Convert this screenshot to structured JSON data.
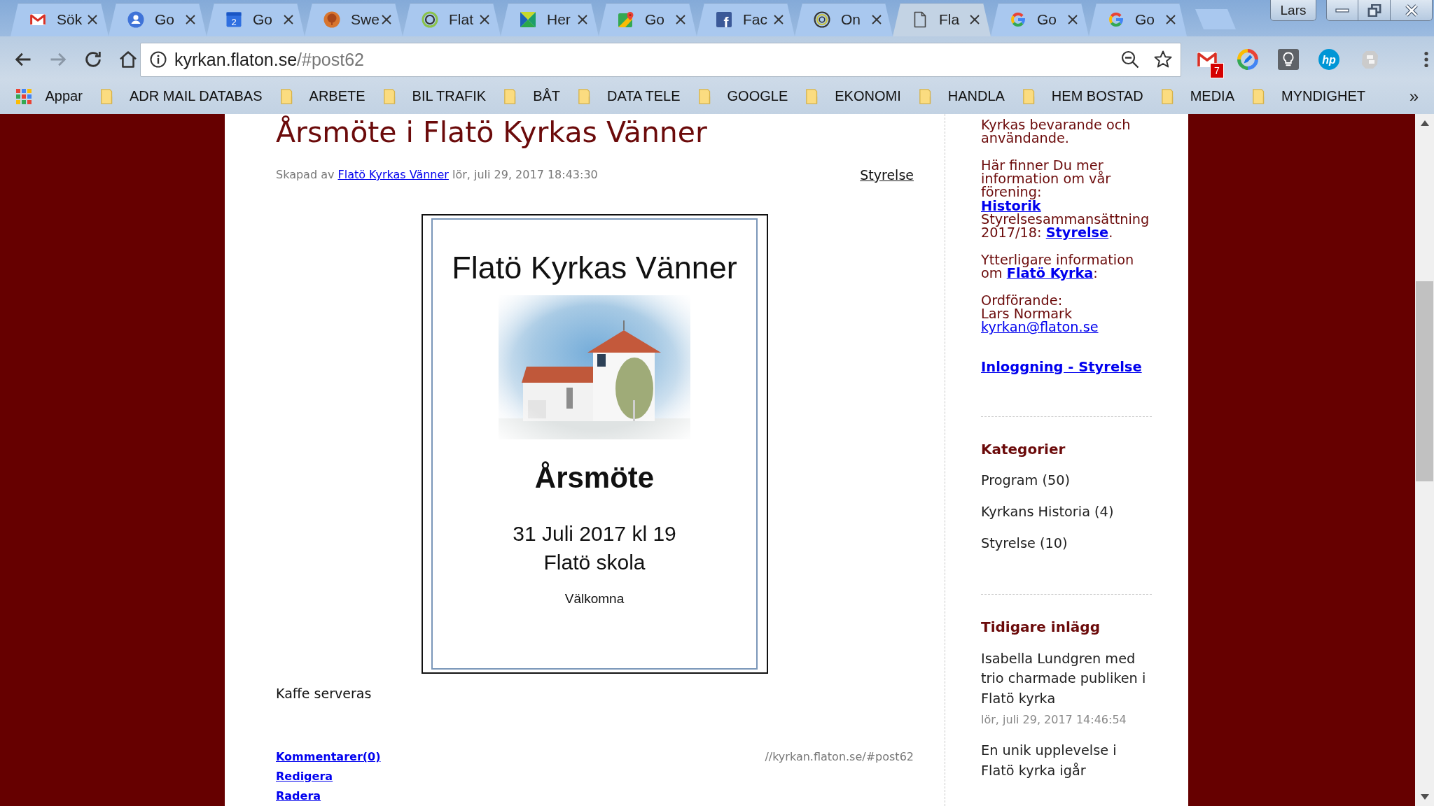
{
  "browser": {
    "tabs": [
      {
        "kind": "gmail",
        "label": "Sök",
        "selected": false
      },
      {
        "kind": "contacts",
        "label": "Go",
        "selected": false
      },
      {
        "kind": "calendar",
        "icon_text": "2",
        "label": "Go",
        "selected": false
      },
      {
        "kind": "tree",
        "label": "Swe",
        "selected": false
      },
      {
        "kind": "ring_green",
        "label": "Flat",
        "selected": false
      },
      {
        "kind": "kite",
        "label": "Her",
        "selected": false
      },
      {
        "kind": "maps",
        "label": "Go",
        "selected": false
      },
      {
        "kind": "facebook",
        "icon_text": "f",
        "label": "Fac",
        "selected": false
      },
      {
        "kind": "ring_yellow",
        "label": "On",
        "selected": false
      },
      {
        "kind": "page",
        "label": "Fla",
        "selected": true
      },
      {
        "kind": "google",
        "label": "Go",
        "selected": false
      },
      {
        "kind": "google",
        "label": "Go",
        "selected": false
      }
    ],
    "profile": "Lars",
    "nav_buttons": [
      {
        "kind": "back",
        "disabled": false
      },
      {
        "kind": "forward",
        "disabled": true
      },
      {
        "kind": "reload",
        "disabled": false
      },
      {
        "kind": "home",
        "disabled": false
      }
    ],
    "address": {
      "host": "kyrkan.flaton.se",
      "path": "/#post62"
    },
    "extensions": [
      {
        "kind": "mail",
        "badge": "7"
      },
      {
        "kind": "pen"
      },
      {
        "kind": "bulb"
      },
      {
        "kind": "logo",
        "label": "hp"
      },
      {
        "kind": "cloud"
      }
    ],
    "bookmarks": [
      {
        "kind": "apps",
        "label": "Appar"
      },
      {
        "kind": "folder",
        "label": "ADR MAIL DATABAS"
      },
      {
        "kind": "folder",
        "label": "ARBETE"
      },
      {
        "kind": "folder",
        "label": "BIL TRAFIK"
      },
      {
        "kind": "folder",
        "label": "BÅT"
      },
      {
        "kind": "folder",
        "label": "DATA TELE"
      },
      {
        "kind": "folder",
        "label": "GOOGLE"
      },
      {
        "kind": "folder",
        "label": "EKONOMI"
      },
      {
        "kind": "folder",
        "label": "HANDLA"
      },
      {
        "kind": "folder",
        "label": "HEM BOSTAD"
      },
      {
        "kind": "folder",
        "label": "MEDIA"
      },
      {
        "kind": "folder",
        "label": "MYNDIGHET"
      }
    ],
    "bookmarks_overflow": "»"
  },
  "page": {
    "post": {
      "title": "Årsmöte i Flatö Kyrkas Vänner",
      "byline": {
        "prefix": "Skapad av",
        "author": "Flatö Kyrkas Vänner",
        "date": "lör, juli 29, 2017 18:43:30"
      },
      "category": "Styrelse",
      "poster": {
        "heading": "Flatö Kyrkas Vänner",
        "title": "Årsmöte",
        "date": "31 Juli 2017 kl 19",
        "place": "Flatö skola",
        "greeting": "Välkomna"
      },
      "body": "Kaffe serveras",
      "actions": [
        "Kommentarer(0)",
        "Redigera",
        "Radera"
      ],
      "permalink": "//kyrkan.flaton.se/#post62"
    },
    "sidebar": {
      "about": [
        [
          {
            "kind": "text",
            "text": "Kyrkas bevarande och användande."
          }
        ],
        [
          {
            "kind": "text",
            "text": "Här finner Du mer information om vår förening:"
          },
          {
            "kind": "link",
            "text": "Historik"
          },
          {
            "kind": "text_link",
            "text": "Styrelsesammansättning 2017/18:",
            "link": "Styrelse",
            "after": "."
          }
        ],
        [
          {
            "kind": "text_link",
            "text": "Ytterligare information om",
            "link": "Flatö Kyrka",
            "after": ":"
          }
        ],
        [
          {
            "kind": "text",
            "text": "Ordförande:"
          },
          {
            "kind": "text",
            "text": "Lars Normark"
          },
          {
            "kind": "email",
            "text": "kyrkan@flaton.se"
          }
        ]
      ],
      "login_link": "Inloggning - Styrelse",
      "categories": {
        "title": "Kategorier",
        "items": [
          "Program (50)",
          "Kyrkans Historia (4)",
          "Styrelse (10)"
        ]
      },
      "recent_posts": {
        "title": "Tidigare inlägg",
        "items": [
          {
            "title": "Isabella Lundgren med trio charmade publiken i Flatö kyrka",
            "date": "lör, juli 29, 2017 14:46:54"
          },
          {
            "title": "En unik upplevelse i Flatö kyrka igår"
          }
        ]
      }
    }
  }
}
